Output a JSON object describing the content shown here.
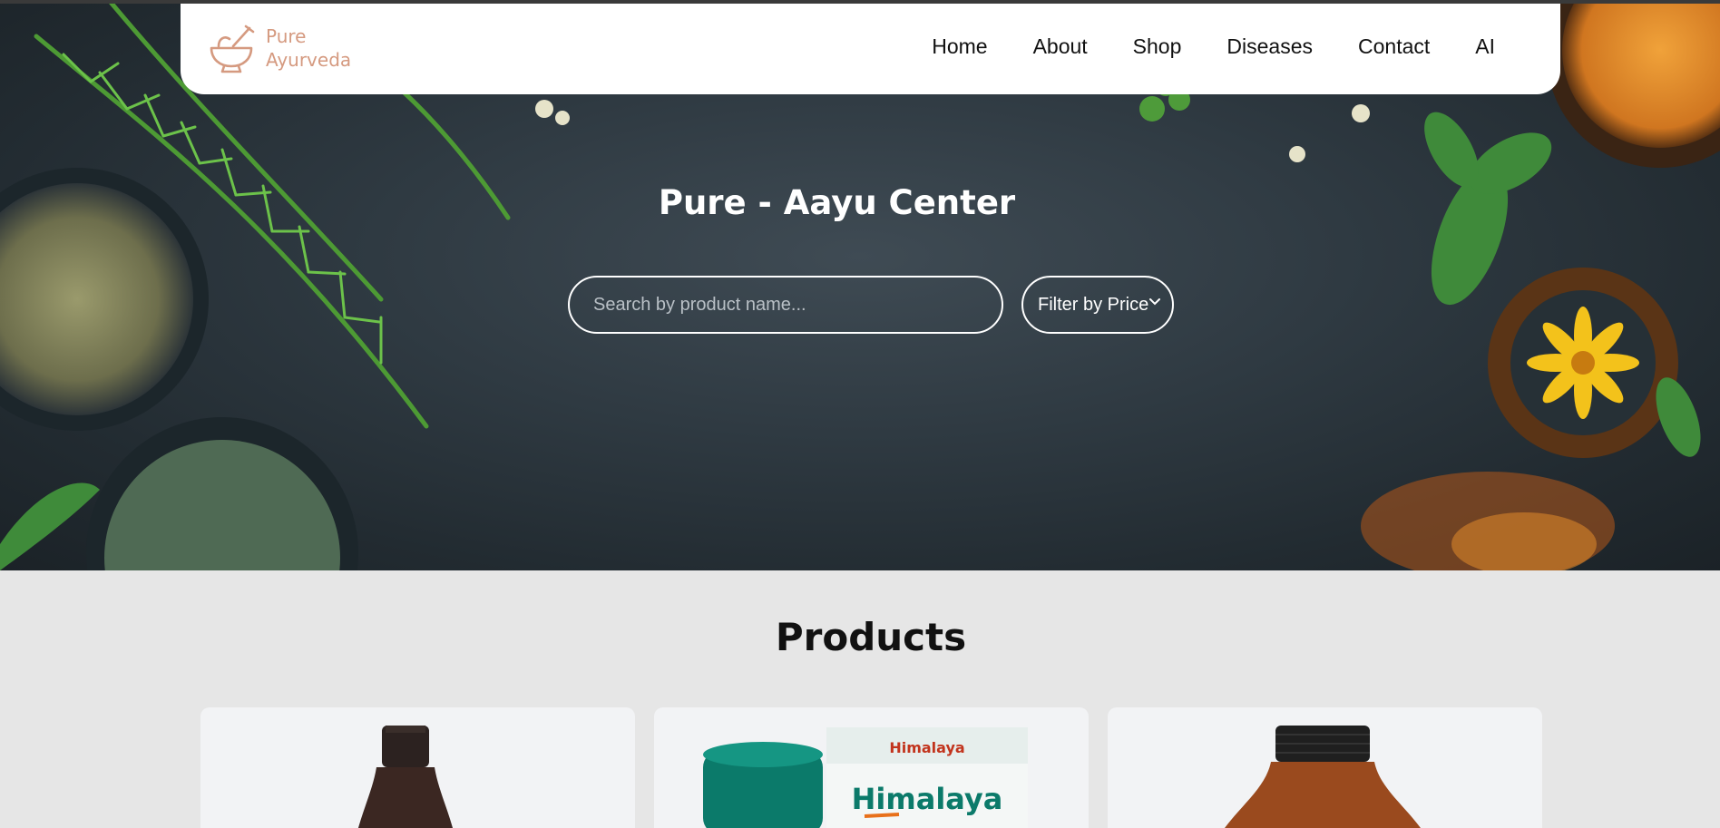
{
  "brand": {
    "line1": "Pure",
    "line2": "Ayurveda"
  },
  "nav": {
    "items": [
      {
        "label": "Home"
      },
      {
        "label": "About"
      },
      {
        "label": "Shop"
      },
      {
        "label": "Diseases"
      },
      {
        "label": "Contact"
      },
      {
        "label": "AI"
      }
    ]
  },
  "hero": {
    "title": "Pure - Aayu Center",
    "search_placeholder": "Search by product name...",
    "filter_label": "Filter by Price"
  },
  "products": {
    "heading": "Products",
    "cards": [
      {
        "image": "dark-bottle"
      },
      {
        "image": "himalaya-ashvagandha-box",
        "brand_text": "Himalaya"
      },
      {
        "image": "amber-bottle"
      }
    ]
  },
  "colors": {
    "logo": "#d59a80",
    "hero_bg": "#2f3a42",
    "page_bg": "#e6e6e6",
    "card_bg": "#f2f3f5",
    "himalaya_green": "#0b7a6a"
  }
}
